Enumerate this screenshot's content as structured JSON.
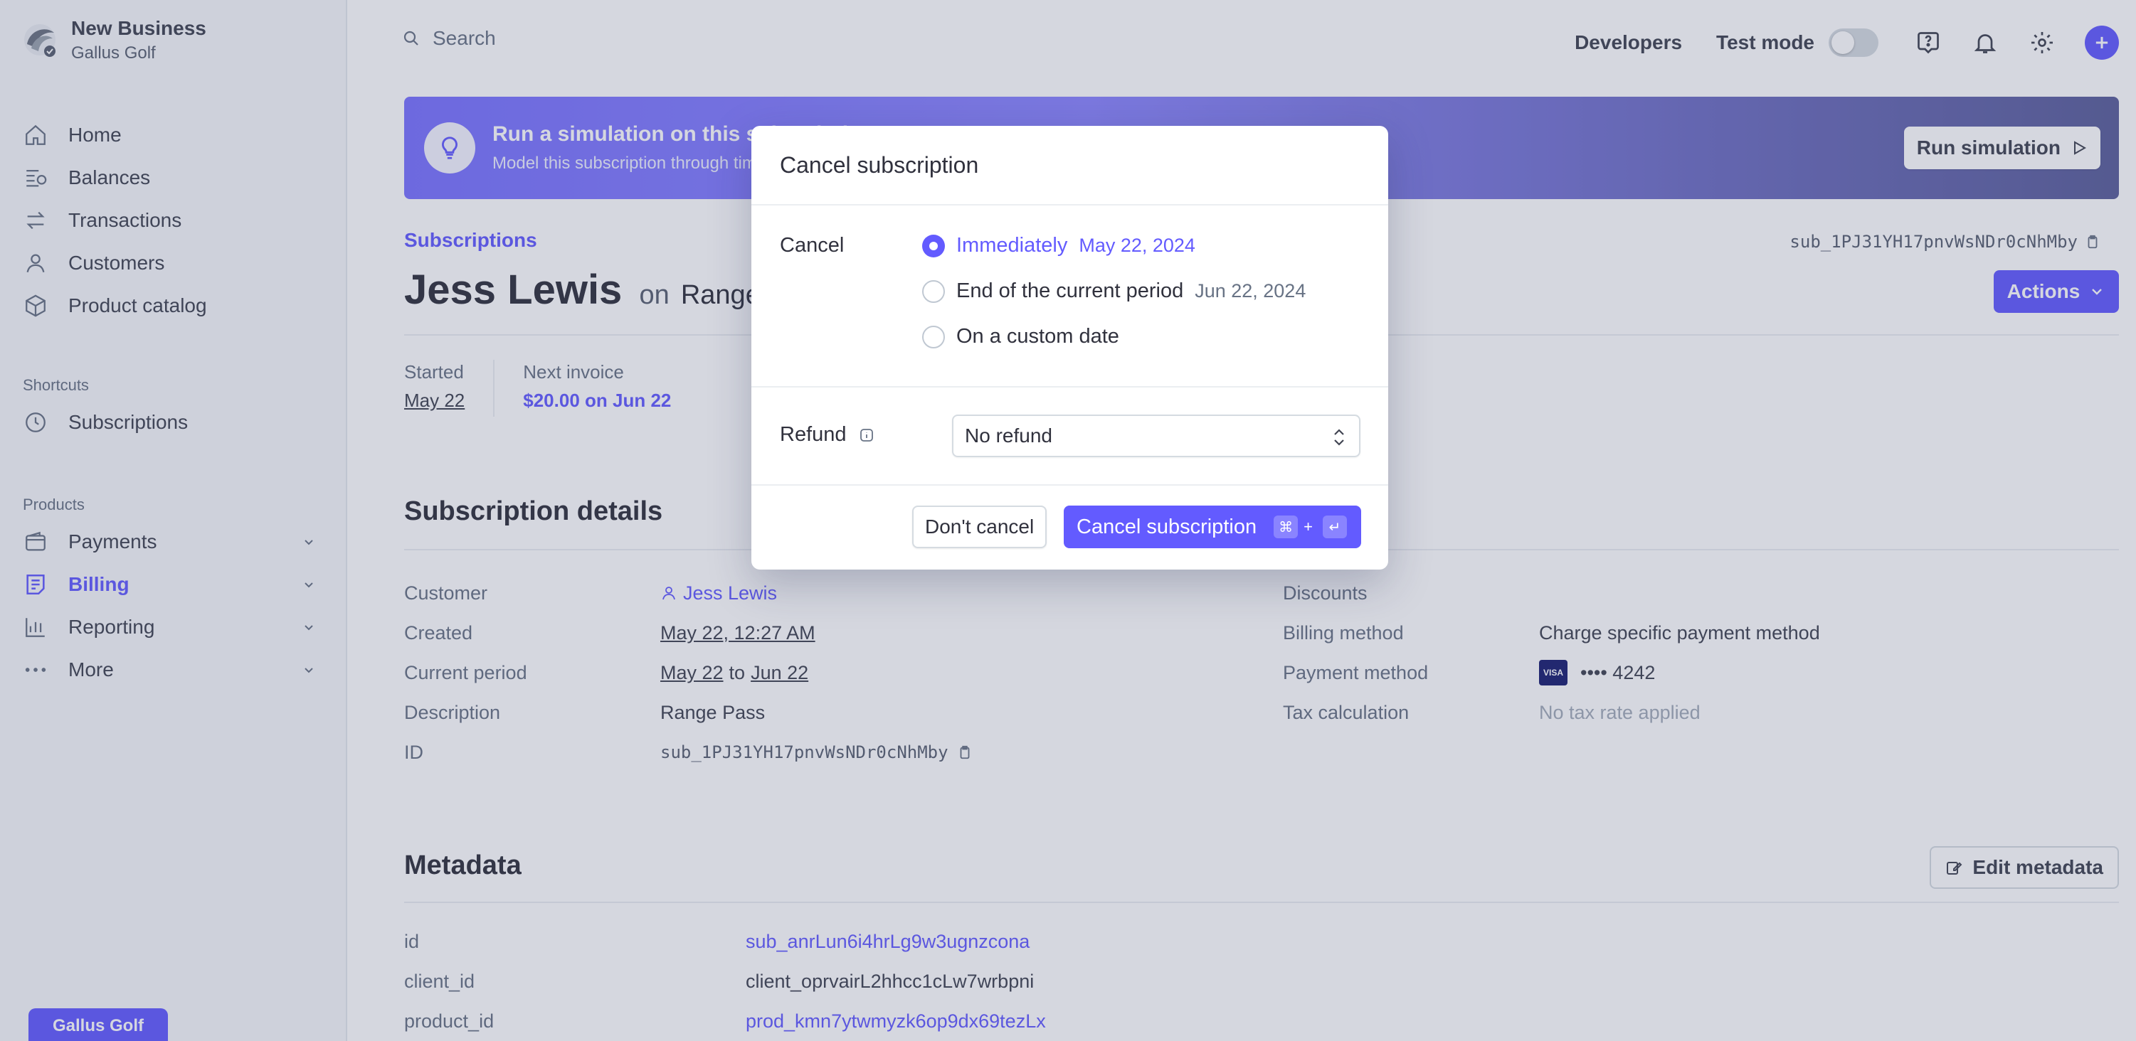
{
  "business": {
    "name": "New Business",
    "account": "Gallus Golf"
  },
  "nav": {
    "main": [
      {
        "label": "Home",
        "icon": "home-icon"
      },
      {
        "label": "Balances",
        "icon": "balances-icon"
      },
      {
        "label": "Transactions",
        "icon": "transactions-icon"
      },
      {
        "label": "Customers",
        "icon": "customers-icon"
      },
      {
        "label": "Product catalog",
        "icon": "product-catalog-icon"
      }
    ],
    "shortcuts_heading": "Shortcuts",
    "shortcuts": [
      {
        "label": "Subscriptions",
        "icon": "clock-icon"
      }
    ],
    "products_heading": "Products",
    "products": [
      {
        "label": "Payments",
        "icon": "wallet-icon"
      },
      {
        "label": "Billing",
        "icon": "billing-icon"
      },
      {
        "label": "Reporting",
        "icon": "chart-icon"
      },
      {
        "label": "More",
        "icon": "more-icon"
      }
    ],
    "bottom_button": "Gallus Golf"
  },
  "topbar": {
    "search_placeholder": "Search",
    "developers": "Developers",
    "test_mode": "Test mode"
  },
  "banner": {
    "title": "Run a simulation on this subscription",
    "subtitle": "Model this subscription through time",
    "button": "Run simulation"
  },
  "page": {
    "breadcrumb": "Subscriptions",
    "subscription_id": "sub_1PJ31YH17pnvWsNDr0cNhMby",
    "customer_name": "Jess Lewis",
    "on": "on",
    "plan": "Range Pass",
    "actions": "Actions",
    "started_label": "Started",
    "started_value": "May 22",
    "next_invoice_label": "Next invoice",
    "next_invoice_value": "$20.00 on Jun 22"
  },
  "details": {
    "title": "Subscription details",
    "customer_label": "Customer",
    "customer_value": "Jess Lewis",
    "created_label": "Created",
    "created_value": "May 22, 12:27 AM",
    "period_label": "Current period",
    "period_start": "May 22",
    "period_to": "to",
    "period_end": "Jun 22",
    "description_label": "Description",
    "description_value": "Range Pass",
    "id_label": "ID",
    "id_value": "sub_1PJ31YH17pnvWsNDr0cNhMby",
    "discounts_label": "Discounts",
    "billing_method_label": "Billing method",
    "billing_method_value": "Charge specific payment method",
    "payment_method_label": "Payment method",
    "payment_brand": "VISA",
    "payment_value": "•••• 4242",
    "tax_label": "Tax calculation",
    "tax_value": "No tax rate applied"
  },
  "metadata": {
    "title": "Metadata",
    "edit_button": "Edit metadata",
    "rows": [
      {
        "key": "id",
        "value": "sub_anrLun6i4hrLg9w3ugnzcona"
      },
      {
        "key": "client_id",
        "value": "client_oprvairL2hhcc1cLw7wrbpni"
      },
      {
        "key": "product_id",
        "value": "prod_kmn7ytwmyzk6op9dx69tezLx"
      }
    ]
  },
  "modal": {
    "title": "Cancel subscription",
    "cancel_label": "Cancel",
    "options": [
      {
        "label": "Immediately",
        "date": "May 22, 2024",
        "selected": true
      },
      {
        "label": "End of the current period",
        "date": "Jun 22, 2024",
        "selected": false
      },
      {
        "label": "On a custom date",
        "date": "",
        "selected": false
      }
    ],
    "refund_label": "Refund",
    "refund_value": "No refund",
    "dont_cancel": "Don't cancel",
    "confirm": "Cancel subscription",
    "shortcut_cmd": "⌘",
    "shortcut_plus": "+",
    "shortcut_enter": "↵"
  },
  "colors": {
    "accent": "#635bff",
    "text": "#30313d",
    "muted": "#687385"
  }
}
